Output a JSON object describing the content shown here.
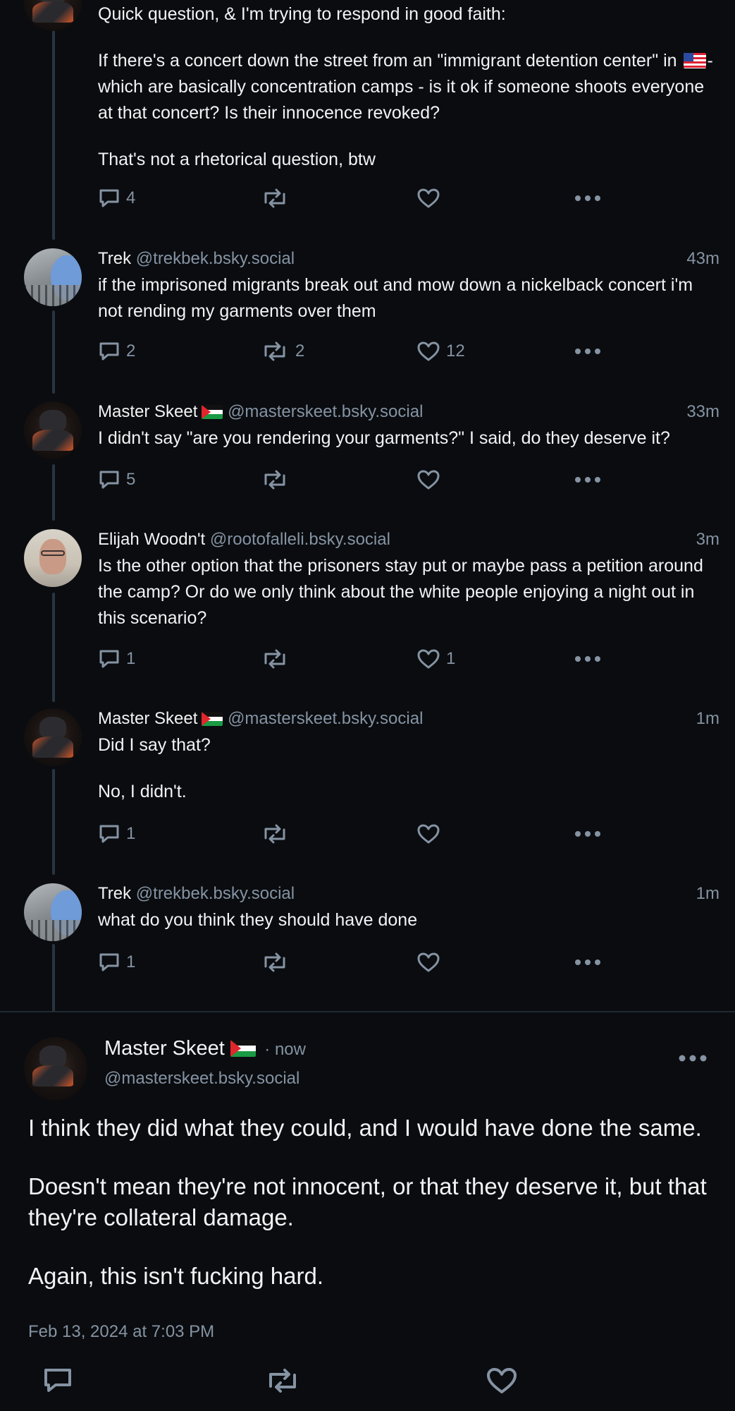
{
  "colors": {
    "background": "#0a0c0f",
    "muted": "#8593a3",
    "text": "#f1f3f5",
    "thread_line": "#2a3440"
  },
  "posts": [
    {
      "avatar": "masterskeet-avatar",
      "paragraphs": [
        "Quick question, & I'm trying to respond in good faith:",
        "If there's a concert down the street from an \"immigrant detention center\" in",
        "- which are basically concentration camps - is it ok if someone shoots everyone at that concert? Is their innocence revoked?",
        "That's not a rhetorical question, btw"
      ],
      "replies": "4",
      "reposts": "",
      "likes": ""
    },
    {
      "name": "Trek",
      "handle": "@trekbek.bsky.social",
      "time": "43m",
      "text": "if the imprisoned migrants break out and mow down a nickelback concert i'm not rending my garments over them",
      "replies": "2",
      "reposts": "2",
      "likes": "12"
    },
    {
      "name": "Master Skeet",
      "handle": "@masterskeet.bsky.social",
      "time": "33m",
      "text": "I didn't say \"are you rendering your garments?\" I said, do they deserve it?",
      "replies": "5",
      "reposts": "",
      "likes": ""
    },
    {
      "name": "Elijah Woodn't",
      "handle": "@rootofalleli.bsky.social",
      "time": "3m",
      "text": "Is the other option that the prisoners stay put or maybe pass a petition around the camp? Or do we only think about the white people enjoying a night out in this scenario?",
      "replies": "1",
      "reposts": "",
      "likes": "1"
    },
    {
      "name": "Master Skeet",
      "handle": "@masterskeet.bsky.social",
      "time": "1m",
      "paragraphs": [
        "Did I say that?",
        "No, I didn't."
      ],
      "replies": "1",
      "reposts": "",
      "likes": ""
    },
    {
      "name": "Trek",
      "handle": "@trekbek.bsky.social",
      "time": "1m",
      "text": "what do you think they should have done",
      "replies": "1",
      "reposts": "",
      "likes": ""
    }
  ],
  "main_post": {
    "name": "Master Skeet",
    "time": "· now",
    "handle": "@masterskeet.bsky.social",
    "paragraphs": [
      "I think they did what they could, and I would have done the same.",
      "Doesn't mean they're not innocent, or that they deserve it, but that they're collateral damage.",
      "Again, this isn't fucking hard."
    ],
    "date": "Feb 13, 2024 at 7:03 PM"
  },
  "icons": {
    "reply": "reply-icon",
    "repost": "repost-icon",
    "like": "like-icon",
    "more": "more-icon",
    "flag_palestine": "palestine-flag-icon",
    "flag_us": "us-flag-icon"
  }
}
